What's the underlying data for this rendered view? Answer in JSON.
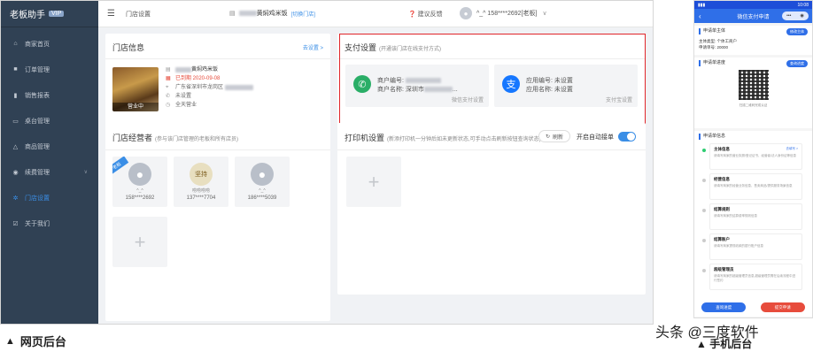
{
  "sidebar": {
    "brand": "老板助手",
    "vip": "VIP",
    "items": [
      {
        "label": "商家首页",
        "icon": "home-icon"
      },
      {
        "label": "订单管理",
        "icon": "order-icon"
      },
      {
        "label": "销售报表",
        "icon": "chart-icon"
      },
      {
        "label": "桌台管理",
        "icon": "table-icon"
      },
      {
        "label": "商品管理",
        "icon": "product-icon"
      },
      {
        "label": "续费管理",
        "icon": "renew-icon"
      },
      {
        "label": "门店设置",
        "icon": "settings-icon",
        "active": true
      },
      {
        "label": "关于我们",
        "icon": "about-icon"
      }
    ]
  },
  "topbar": {
    "breadcrumb": "门店设置",
    "store_name": "黄焖鸡米饭",
    "switch_store": "[切换门店]",
    "feedback": "建议反馈",
    "user": "^_^ 158****2692[老板]"
  },
  "store_info": {
    "title": "门店信息",
    "link": "去设置 >",
    "image_tag": "营业中",
    "name": "黄焖鸡米饭",
    "expire": "已到期 2020-09-08",
    "address": "广东省深圳市龙岗区",
    "phone": "未设置",
    "hours": "全天营业"
  },
  "pay": {
    "title": "支付设置",
    "subtitle": "(开通该门店在线支付方式)",
    "wechat": {
      "merchant_no_label": "商户编号:",
      "merchant_name_label": "商户名称: 深圳市",
      "tag": "微信支付设置"
    },
    "alipay": {
      "app_no": "应用编号: 未设置",
      "app_name": "应用名称: 未设置",
      "tag": "支付宝设置"
    }
  },
  "employees": {
    "title": "门店经营者",
    "subtitle": "(参与该门店管理的老板和所有店员)",
    "ribbon": "老板",
    "list": [
      {
        "name": "^_^",
        "phone": "158****2692"
      },
      {
        "name": "唠唠唠唠",
        "phone": "137****7704"
      },
      {
        "name": "^_^",
        "phone": "186****5039"
      }
    ]
  },
  "printer": {
    "title": "打印机设置",
    "subtitle": "(新添打印机一分钟后如未更新状态,可手动点击刷新按钮查询状态)",
    "refresh": "刷新",
    "auto_accept": "开启自动接单"
  },
  "captions": {
    "web": "网页后台",
    "mobile": "手机后台",
    "watermark": "头条 @三度软件"
  },
  "phone": {
    "status_time": "10:08",
    "header": "微信支付申请",
    "section1": "申请单主体",
    "section1_btn": "修改主体",
    "subject_type": "主体类型:  个体工商户",
    "apply_no": "申请单号:  20000",
    "section2": "申请单进度",
    "section2_btn": "查询进度",
    "qr_caption": "扫描二维码完成认证",
    "section3": "申请单信息",
    "steps": [
      {
        "title": "主体信息",
        "desc": "请填写商家的营业执照/登记证书、经营者/法人身份证等信息",
        "link": "去填写 >"
      },
      {
        "title": "经营信息",
        "desc": "请填写商家的经营业务信息、售卖商品/提供服务场景信息"
      },
      {
        "title": "结算规则",
        "desc": "请填写商家的结算费率规则信息"
      },
      {
        "title": "结算账户",
        "desc": "请填写商家提现收款的银行账户信息"
      },
      {
        "title": "超级管理员",
        "desc": "请填写商家的超级管理员信息,超级管理员需在后续流程中进行签约"
      }
    ],
    "btn_query": "查询进度",
    "btn_submit": "提交申请"
  }
}
